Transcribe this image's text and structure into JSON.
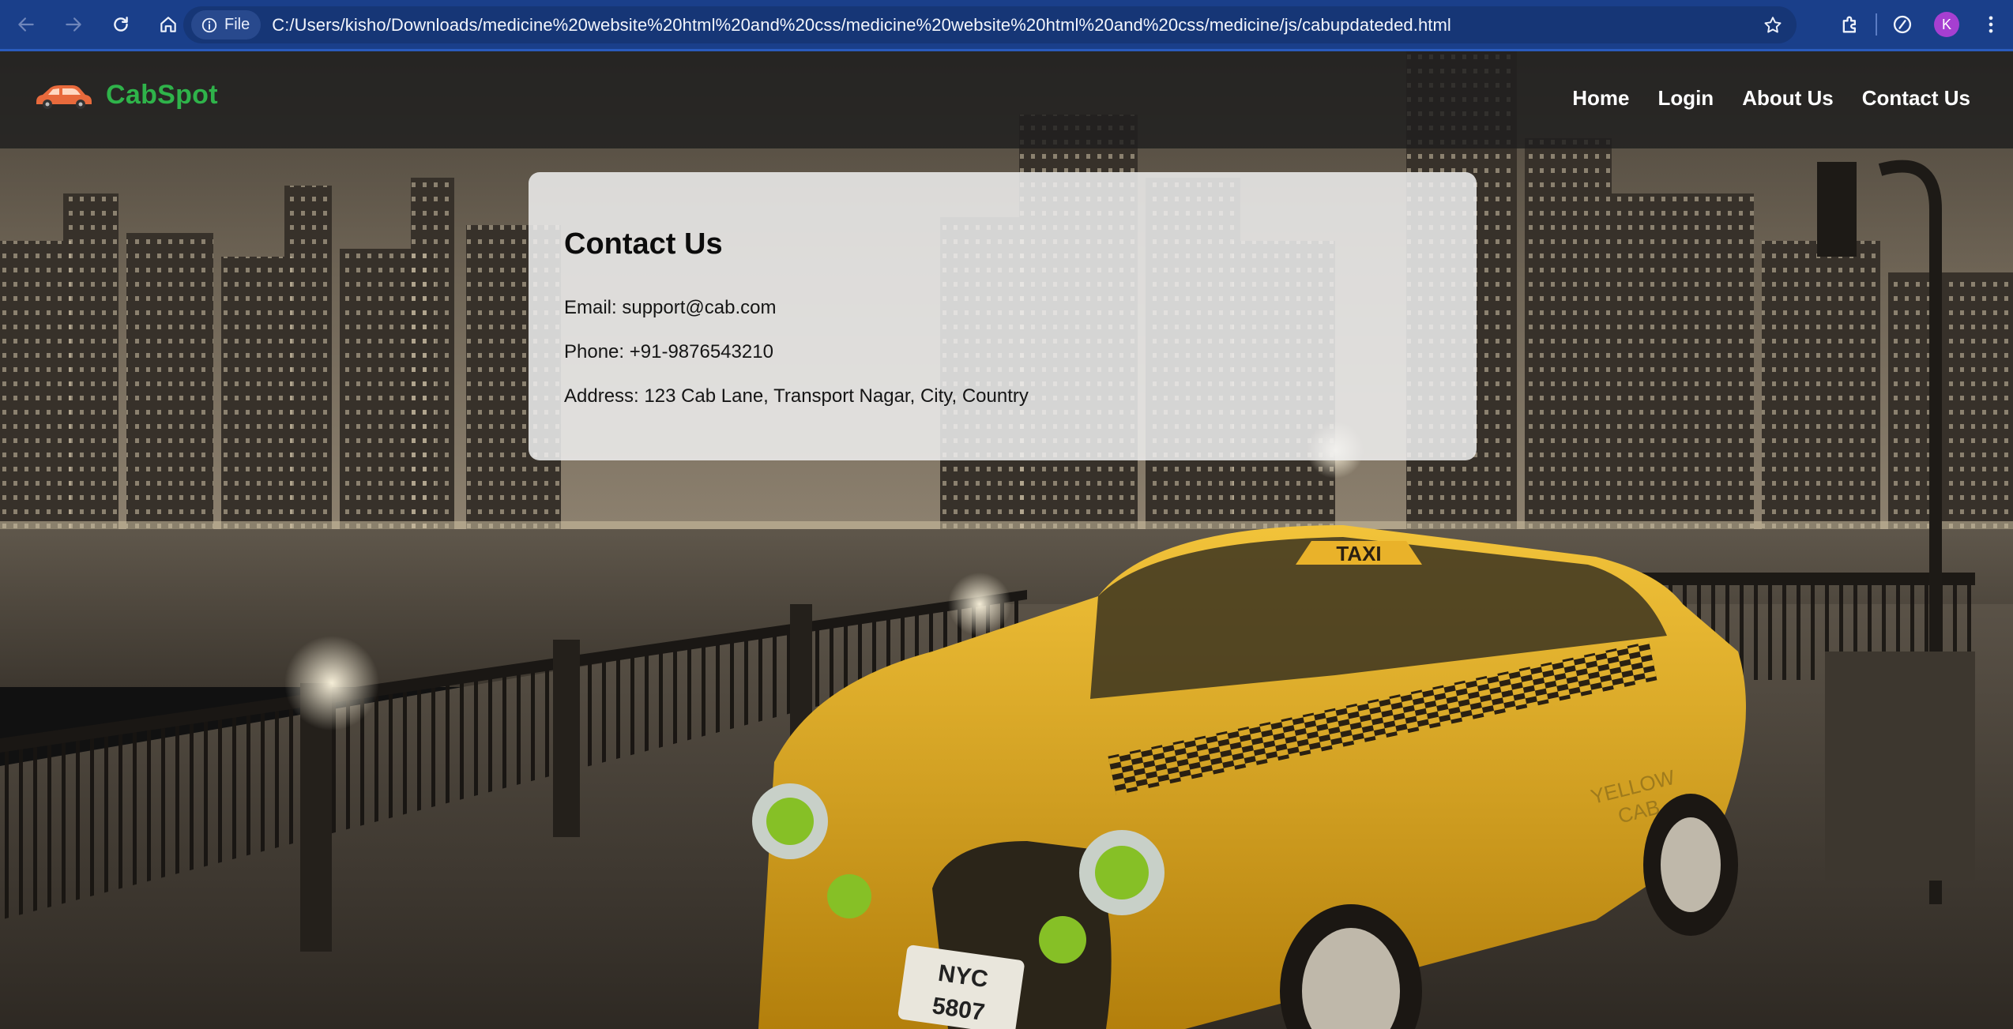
{
  "browser": {
    "site_chip_label": "File",
    "url": "C:/Users/kisho/Downloads/medicine%20website%20html%20and%20css/medicine%20website%20html%20and%20css/medicine/js/cabupdateded.html",
    "profile_initial": "K",
    "icons": {
      "back": "back-arrow-icon",
      "forward": "forward-arrow-icon",
      "reload": "reload-icon",
      "home": "home-icon",
      "site_info": "info-icon",
      "bookmark": "star-icon",
      "extensions": "puzzle-icon",
      "performance": "speedometer-icon",
      "menu": "kebab-menu-icon"
    },
    "colors": {
      "toolbar": "#1a3f8a",
      "omnibox": "#163676",
      "avatar": "#a63fd1"
    }
  },
  "site": {
    "brand": {
      "name": "CabSpot",
      "logo_icon": "car-icon",
      "color": "#2fb34a"
    },
    "nav": [
      {
        "label": "Home"
      },
      {
        "label": "Login"
      },
      {
        "label": "About Us"
      },
      {
        "label": "Contact Us"
      }
    ],
    "contact": {
      "title": "Contact Us",
      "email_line": "Email: support@cab.com",
      "phone_line": "Phone: +91-9876543210",
      "address_line": "Address: 123 Cab Lane, Transport Nagar, City, Country"
    },
    "background": {
      "taxi_sign": "TAXI",
      "plate_line1": "NYC",
      "plate_line2": "5807",
      "door_text_line1": "YELLOW",
      "door_text_line2": "CAB"
    }
  }
}
